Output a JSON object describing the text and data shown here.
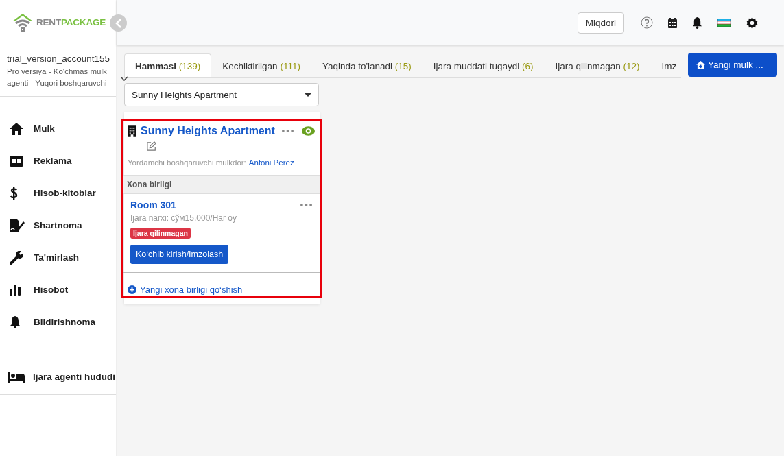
{
  "logo": {
    "word_1": "RENT",
    "word_2": "PACKAGE"
  },
  "header": {
    "amount_button": "Miqdori"
  },
  "account": {
    "username": "trial_version_account155",
    "role": "Pro versiya - Ko‘chmas mulk agenti - Yuqori boshqaruvchi"
  },
  "sidebar": {
    "items": [
      {
        "kind": "home",
        "label": "Mulk"
      },
      {
        "kind": "ad",
        "label": "Reklama"
      },
      {
        "kind": "dollar",
        "label": "Hisob-kitoblar"
      },
      {
        "kind": "contract",
        "label": "Shartnoma"
      },
      {
        "kind": "wrench",
        "label": "Ta'mirlash"
      },
      {
        "kind": "chart",
        "label": "Hisobot"
      },
      {
        "kind": "bell",
        "label": "Bildirishnoma"
      }
    ],
    "footer_item": {
      "kind": "bed",
      "label": "Ijara agenti hududi"
    }
  },
  "tabs": [
    {
      "label": "Hammasi",
      "count": "(139)",
      "selected": true
    },
    {
      "label": "Kechiktirilgan",
      "count": "(111)",
      "selected": false
    },
    {
      "label": "Yaqinda to'lanadi",
      "count": "(15)",
      "selected": false
    },
    {
      "label": "Ijara muddati tugaydi",
      "count": "(6)",
      "selected": false
    },
    {
      "label": "Ijara qilinmagan",
      "count": "(12)",
      "selected": false
    },
    {
      "label": "Imz",
      "selected": false
    }
  ],
  "new_property_button": "Yangi mulk ...",
  "property_select": {
    "value": "Sunny Heights Apartment"
  },
  "property_card": {
    "highlighted": true,
    "title": "Sunny Heights Apartment",
    "manager_label": "Yordamchi boshqaruvchi mulkdor:",
    "manager_name": "Antoni Perez",
    "section_title": "Xona birligi",
    "units": [
      {
        "name": "Room 301",
        "price": "Ijara narxi: сўм15,000/Har oy",
        "status": "Ijara qilinmagan",
        "action": "Ko‘chib kirish/Imzolash"
      }
    ],
    "add_unit": "Yangi xona birligi qo‘shish"
  }
}
